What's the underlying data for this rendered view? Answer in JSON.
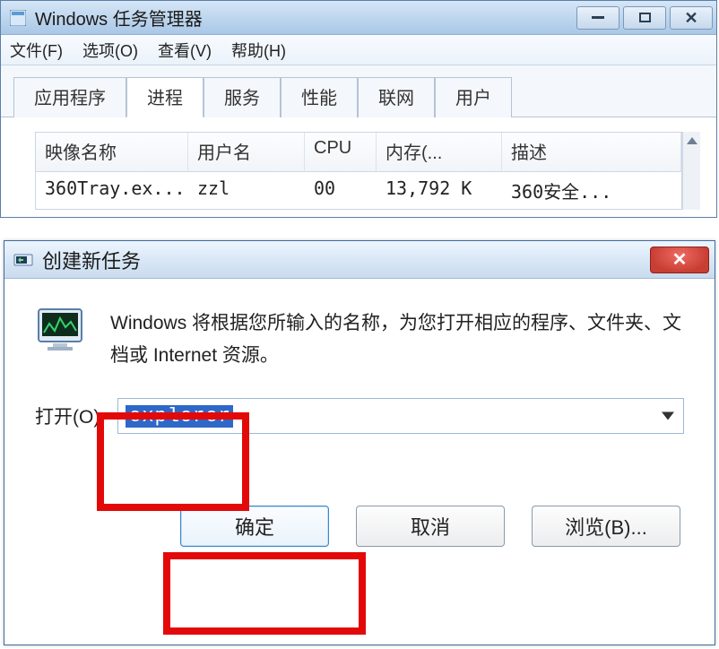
{
  "taskmgr": {
    "title": "Windows 任务管理器",
    "menu": {
      "file": "文件(F)",
      "options": "选项(O)",
      "view": "查看(V)",
      "help": "帮助(H)"
    },
    "tabs": {
      "apps": "应用程序",
      "processes": "进程",
      "services": "服务",
      "performance": "性能",
      "networking": "联网",
      "users": "用户"
    },
    "columns": {
      "image": "映像名称",
      "user": "用户名",
      "cpu": "CPU",
      "memory": "内存(...",
      "description": "描述"
    },
    "rows": [
      {
        "image": "360Tray.ex...",
        "user": "zzl",
        "cpu": "00",
        "memory": "13,792 K",
        "description": "360安全..."
      }
    ]
  },
  "dialog": {
    "title": "创建新任务",
    "info": "Windows 将根据您所输入的名称，为您打开相应的程序、文件夹、文档或 Internet 资源。",
    "open_label": "打开(O):",
    "open_value": "explorer",
    "buttons": {
      "ok": "确定",
      "cancel": "取消",
      "browse": "浏览(B)..."
    }
  }
}
